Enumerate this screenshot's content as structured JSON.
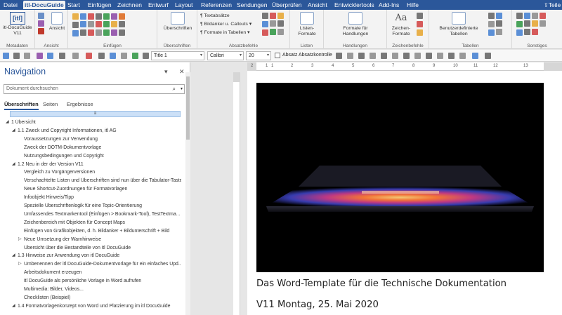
{
  "ribbon_tabs": [
    "Datei",
    "itl-DocuGuide",
    "Start",
    "Einfügen",
    "Zeichnen",
    "Entwurf",
    "Layout",
    "Referenzen",
    "Sendungen",
    "Überprüfen",
    "Ansicht",
    "Entwicklertools",
    "Add-Ins",
    "Hilfe"
  ],
  "share_label": "Teile",
  "ribbon": {
    "metadaten": {
      "logo": "[itl]",
      "button": "itl-DocuGuide",
      "version": "V11",
      "label": "Metadaten"
    },
    "ansicht": {
      "button": "Ansicht",
      "label": "Ansicht"
    },
    "einfuegen": {
      "label": "Einfügen"
    },
    "ueberschriften": {
      "button": "Überschriften",
      "label": "Überschriften"
    },
    "absatz": {
      "items": [
        "Textabsätze",
        "Bildanker u. Callouts",
        "Formate in Tabellen"
      ],
      "label": "Absatzbefehle"
    },
    "listen": {
      "button": "Listen-Formate",
      "label": "Listen"
    },
    "handlungen": {
      "button": "Formate für Handlungen",
      "label": "Handlungen"
    },
    "zeichen": {
      "button": "Zeichen-Formate",
      "label": "Zeichenbefehle"
    },
    "tabellen": {
      "button": "Benutzerdefinierte Tabellen",
      "label": "Tabellen"
    },
    "sonstiges": {
      "label": "Sonstiges"
    }
  },
  "qat": {
    "style_value": "Title 1",
    "font_value": "Calibri",
    "size_value": "20",
    "checkbox_label": "Absatz Absatzkontrolle"
  },
  "nav": {
    "title": "Navigation",
    "search_placeholder": "Dokument durchsuchen",
    "tabs": [
      "Überschriften",
      "Seiten",
      "Ergebnisse"
    ],
    "collapse_glyph": "≡",
    "items": [
      {
        "text": "1 Übersicht",
        "level": 0,
        "expanded": true
      },
      {
        "text": "1.1 Zweck und Copyright Informationen, itl AG",
        "level": 1,
        "expanded": true
      },
      {
        "text": "Voraussetzungen zur Verwendung",
        "level": 2
      },
      {
        "text": "Zweck der DOTM-Dokumentvorlage",
        "level": 2
      },
      {
        "text": "Nutzungsbedingungen und Copyright",
        "level": 2
      },
      {
        "text": "1.2 Neu in der der Version V11",
        "level": 1,
        "expanded": true
      },
      {
        "text": "Vergleich zu Vorgängerversionen",
        "level": 2
      },
      {
        "text": "Verschachtelte Listen und Überschriften sind nun über die Tabulator-Taste...",
        "level": 2
      },
      {
        "text": "Neue Shortcut-Zuordnungen für Formatvorlagen",
        "level": 2
      },
      {
        "text": "Infoobjekt Hinweis/Tipp",
        "level": 2
      },
      {
        "text": "Spezielle Überschriftenlogik für eine Topic-Orientierung",
        "level": 2
      },
      {
        "text": "Umfassendes Textmarkentool  (Einfügen >  Bookmark-Tool),  TestTextma...",
        "level": 2
      },
      {
        "text": "Zeichenbereich mit Objekten für Concept Maps",
        "level": 2
      },
      {
        "text": "Einfügen von Grafikobjekten, d. h. Bildanker + Bildunterschrift + Bild",
        "level": 2
      },
      {
        "text": "Neue Umsetzung der Warnhinweise",
        "level": 2,
        "collapsed": true
      },
      {
        "text": "Übersicht über die Bestandteile von itl DocuGuide",
        "level": 2
      },
      {
        "text": "1.3 Hinweise zur Anwendung von itl DocuGuide",
        "level": 1,
        "expanded": true
      },
      {
        "text": "Umbenennen der itl DocuGuide-Dokumentvorlage für ein einfaches Upd...",
        "level": 2,
        "collapsed": true
      },
      {
        "text": "Arbeitsdokument erzeugen",
        "level": 2
      },
      {
        "text": "itl DocuGuide als persönliche Vorlage in Word aufrufen",
        "level": 2
      },
      {
        "text": "Multimedia: Bilder, Videos...",
        "level": 2
      },
      {
        "text": "Checklisten (Beispiel)",
        "level": 2
      },
      {
        "text": "1.4 Formatvorlagenkonzept von Word und Platzierung im itl DocuGuide",
        "level": 1,
        "expanded": true
      }
    ]
  },
  "ruler": {
    "ticks": [
      "1",
      "2",
      "1",
      "2",
      "3",
      "4",
      "5",
      "6",
      "7",
      "8",
      "9",
      "10",
      "11",
      "12",
      "13"
    ]
  },
  "document": {
    "line1": "Das Word-Template für die Technische Dokumentation",
    "line2": "V11 Montag, 25. Mai 2020"
  },
  "colors": {
    "accent": "#2b579a",
    "selection": "#cce0f7"
  }
}
